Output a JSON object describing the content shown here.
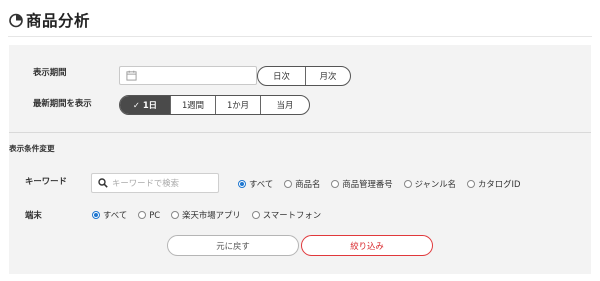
{
  "header": {
    "title": "商品分析",
    "icon": "pie-chart-icon"
  },
  "period": {
    "label": "表示期間",
    "date_value": "",
    "range_buttons": [
      {
        "label": "日次"
      },
      {
        "label": "月次"
      }
    ]
  },
  "latest": {
    "label": "最新期間を表示",
    "options": [
      {
        "label": "✓ 1日",
        "active": true
      },
      {
        "label": "1週間",
        "active": false
      },
      {
        "label": "1か月",
        "active": false
      },
      {
        "label": "当月",
        "active": false
      }
    ]
  },
  "conditions": {
    "section_label": "表示条件変更",
    "keyword": {
      "label": "キーワード",
      "placeholder": "キーワードで検索",
      "scope_options": [
        {
          "label": "すべて",
          "selected": true
        },
        {
          "label": "商品名",
          "selected": false
        },
        {
          "label": "商品管理番号",
          "selected": false
        },
        {
          "label": "ジャンル名",
          "selected": false
        },
        {
          "label": "カタログID",
          "selected": false
        }
      ]
    },
    "device": {
      "label": "端末",
      "options": [
        {
          "label": "すべて",
          "selected": true
        },
        {
          "label": "PC",
          "selected": false
        },
        {
          "label": "楽天市場アプリ",
          "selected": false
        },
        {
          "label": "スマートフォン",
          "selected": false
        }
      ]
    }
  },
  "actions": {
    "reset_label": "元に戻す",
    "filter_label": "絞り込み"
  },
  "colors": {
    "accent_red": "#d8262a",
    "radio_blue": "#1f77d0",
    "active_segment": "#4a4a4a",
    "panel_bg": "#f3f3f3"
  }
}
